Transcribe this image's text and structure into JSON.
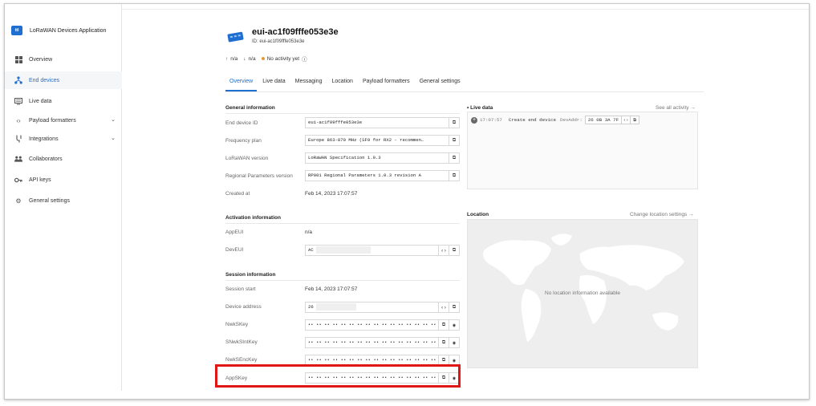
{
  "sidebar": {
    "app_logo_text": "ttI",
    "app_title": "LoRaWAN Devices Application",
    "items": [
      {
        "label": "Overview",
        "icon": "grid-icon"
      },
      {
        "label": "End devices",
        "icon": "network-icon",
        "active": true
      },
      {
        "label": "Live data",
        "icon": "monitor-icon"
      },
      {
        "label": "Payload formatters",
        "icon": "code-icon",
        "chevron": true
      },
      {
        "label": "Integrations",
        "icon": "integrations-icon",
        "chevron": true
      },
      {
        "label": "Collaborators",
        "icon": "people-icon"
      },
      {
        "label": "API keys",
        "icon": "key-icon"
      },
      {
        "label": "General settings",
        "icon": "gear-icon"
      }
    ]
  },
  "header": {
    "title": "eui-ac1f09fffe053e3e",
    "id_line": "ID: eui-ac1f09fffe053e3e",
    "uplink": "n/a",
    "downlink": "n/a",
    "activity": "No activity yet",
    "activity_color": "#e49b2c"
  },
  "tabs": [
    "Overview",
    "Live data",
    "Messaging",
    "Location",
    "Payload formatters",
    "General settings"
  ],
  "general": {
    "title": "General information",
    "end_device_id": {
      "label": "End device ID",
      "value": "eui-ac1f09fffe053e3e"
    },
    "frequency_plan": {
      "label": "Frequency plan",
      "value": "Europe 863-870 MHz (SF9 for RX2 - recommen…"
    },
    "lorawan_version": {
      "label": "LoRaWAN version",
      "value": "LoRaWAN Specification 1.0.3"
    },
    "regional_params": {
      "label": "Regional Parameters version",
      "value": "RP001 Regional Parameters 1.0.3 revision A"
    },
    "created_at": {
      "label": "Created at",
      "value": "Feb 14, 2023 17:07:57"
    }
  },
  "activation": {
    "title": "Activation information",
    "app_eui": {
      "label": "AppEUI",
      "value": "n/a"
    },
    "dev_eui": {
      "label": "DevEUI",
      "value": "AC"
    }
  },
  "session": {
    "title": "Session information",
    "start": {
      "label": "Session start",
      "value": "Feb 14, 2023 17:07:57"
    },
    "device_address": {
      "label": "Device address",
      "value": "26"
    },
    "nwk_s_key": {
      "label": "NwkSKey",
      "value": "•• •• •• •• •• •• •• •• •• •• •• •• •• •• •• ••"
    },
    "s_nwk_s_int_key": {
      "label": "SNwkSIntKey",
      "value": "•• •• •• •• •• •• •• •• •• •• •• •• •• •• •• ••"
    },
    "nwk_s_enc_key": {
      "label": "NwkSEncKey",
      "value": "•• •• •• •• •• •• •• •• •• •• •• •• •• •• •• ••"
    },
    "app_s_key": {
      "label": "AppSKey",
      "value": "•• •• •• •• •• •• •• •• •• •• •• •• •• •• •• ••"
    }
  },
  "live_data": {
    "title": "Live data",
    "link": "See all activity →",
    "event": {
      "time": "17:07:57",
      "type": "Create end device",
      "key": "DevAddr:",
      "value": "26 0B 3A 7F"
    }
  },
  "location": {
    "title": "Location",
    "link": "Change location settings →",
    "message": "No location information available"
  },
  "highlight_color": "#e01717"
}
